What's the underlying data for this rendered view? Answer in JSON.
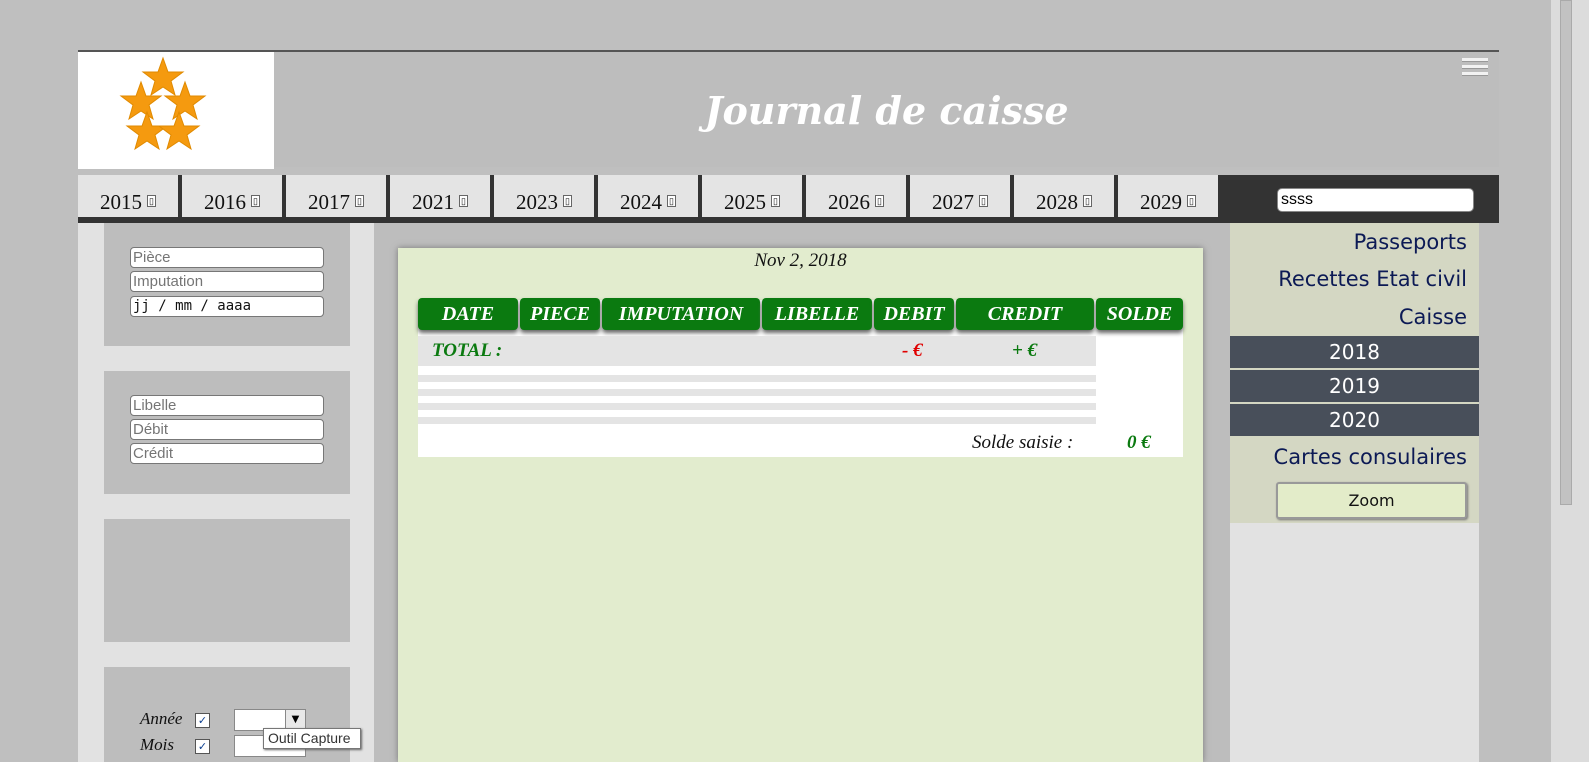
{
  "header": {
    "title": "Journal de caisse",
    "menu_icon": "hamburger-icon",
    "logo": "five-star-ring-logo"
  },
  "year_tabs": [
    {
      "label": "2015",
      "icon": "tab-icon"
    },
    {
      "label": "2016",
      "icon": "tab-icon"
    },
    {
      "label": "2017",
      "icon": "tab-icon"
    },
    {
      "label": "2021",
      "icon": "tab-icon"
    },
    {
      "label": "2023",
      "icon": "tab-icon"
    },
    {
      "label": "2024",
      "icon": "tab-icon"
    },
    {
      "label": "2025",
      "icon": "tab-icon"
    },
    {
      "label": "2026",
      "icon": "tab-icon"
    },
    {
      "label": "2027",
      "icon": "tab-icon"
    },
    {
      "label": "2028",
      "icon": "tab-icon"
    },
    {
      "label": "2029",
      "icon": "tab-icon"
    }
  ],
  "search": {
    "value": "ssss"
  },
  "left_form": {
    "piece_placeholder": "Pièce",
    "imputation_placeholder": "Imputation",
    "date_placeholder": "jj / mm / aaaa",
    "libelle_placeholder": "Libelle",
    "debit_placeholder": "Débit",
    "credit_placeholder": "Crédit",
    "annee_label": "Année",
    "mois_label": "Mois",
    "annee_checked": true,
    "mois_checked": true
  },
  "journal": {
    "date": "Nov 2, 2018",
    "columns": [
      "DATE",
      "PIECE",
      "IMPUTATION",
      "LIBELLE",
      "DEBIT",
      "CREDIT",
      "SOLDE"
    ],
    "total_label": "TOTAL :",
    "total_debit": "- €",
    "total_credit": "+ €",
    "solde_label": "Solde saisie :",
    "solde_value": "0 €",
    "colors": {
      "header_bg": "#0b7a10",
      "debit": "#e00000",
      "credit": "#0b7a10"
    }
  },
  "right_nav": {
    "links": [
      "Passeports",
      "Recettes Etat civil",
      "Caisse"
    ],
    "years": [
      "2018",
      "2019",
      "2020"
    ],
    "consular": "Cartes consulaires",
    "zoom_label": "Zoom"
  },
  "tooltip": "Outil Capture"
}
